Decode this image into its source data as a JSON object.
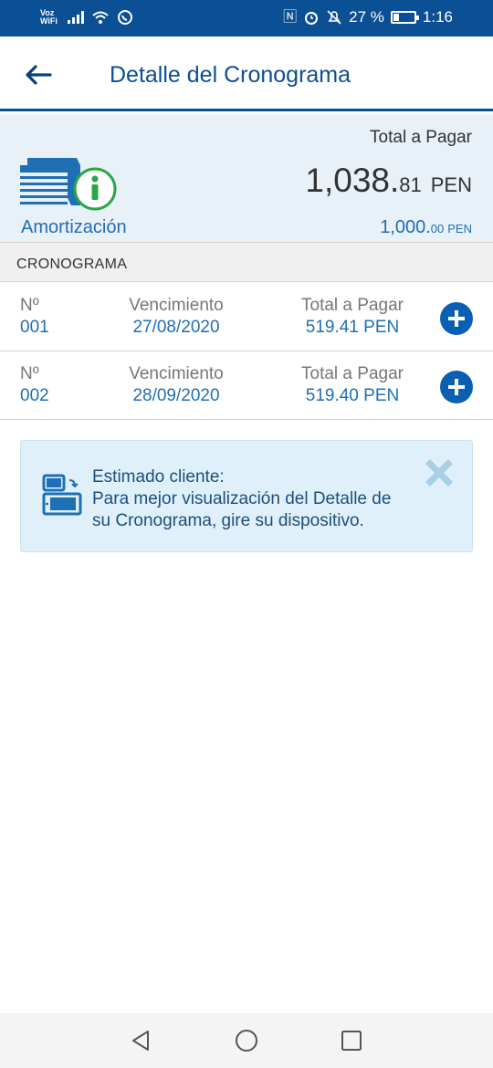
{
  "status_bar": {
    "carrier_line1": "Voz",
    "carrier_line2": "WiFi",
    "battery": "27 %",
    "battery_level": 0.27,
    "time": "1:16"
  },
  "header": {
    "title": "Detalle del Cronograma",
    "back_icon": "arrow-left-icon"
  },
  "summary": {
    "total_label": "Total a Pagar",
    "total_int": "1,038.",
    "total_dec": "81",
    "total_currency": "PEN",
    "type_label": "Amortización",
    "sub_int": "1,000.",
    "sub_dec": "00",
    "sub_currency": "PEN"
  },
  "section": {
    "title": "CRONOGRAMA"
  },
  "columns": {
    "no": "Nº",
    "due": "Vencimiento",
    "total": "Total a Pagar"
  },
  "rows": [
    {
      "no": "001",
      "due": "27/08/2020",
      "total": "519.41 PEN"
    },
    {
      "no": "002",
      "due": "28/09/2020",
      "total": "519.40 PEN"
    }
  ],
  "info": {
    "line1": "Estimado cliente:",
    "line2": "Para mejor visualización del Detalle de",
    "line3": "su Cronograma, gire su dispositivo."
  },
  "colors": {
    "primary": "#0b4f94",
    "link": "#1f6fb4",
    "info_bg": "#dff0fa",
    "success_green": "#27a844"
  }
}
